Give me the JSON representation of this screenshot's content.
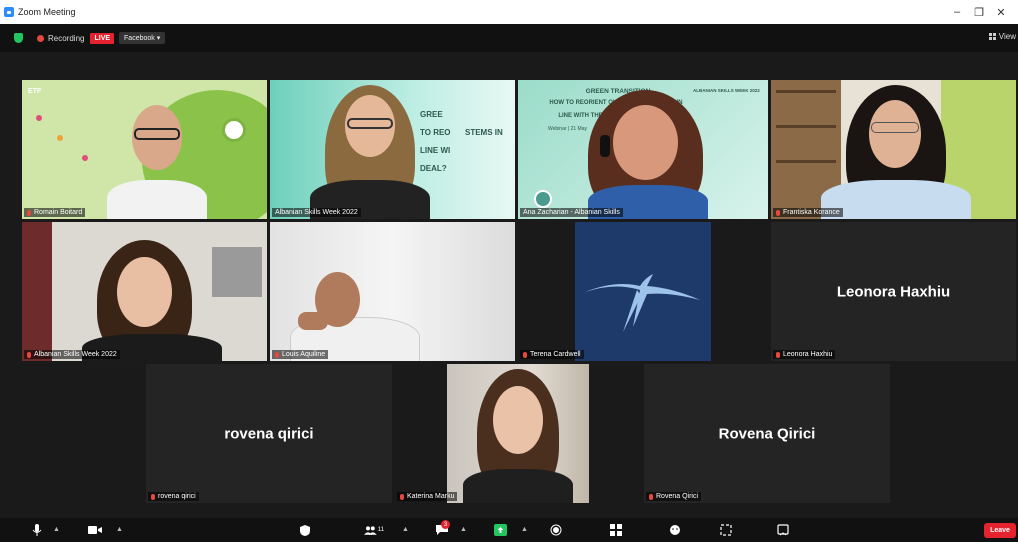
{
  "window": {
    "title": "Zoom Meeting",
    "minimize": "–",
    "restore": "❐",
    "close": "✕"
  },
  "topbar": {
    "recording_label": "Recording",
    "live_label": "LIVE",
    "stream_label": "Facebook ▾",
    "view_label": "View"
  },
  "tiles": [
    {
      "name": "Romain Boitard"
    },
    {
      "name": "Albanian Skills Week 2022"
    },
    {
      "name": "Ana Zacharian - Albanian Skills"
    },
    {
      "name": "Frantiska Korance"
    },
    {
      "name": "Albanian Skills Week 2022"
    },
    {
      "name": "Louis Aquiline"
    },
    {
      "name": "Terena Cardwell"
    },
    {
      "name": "Leonora Haxhiu",
      "display": "Leonora Haxhiu"
    },
    {
      "name": "rovena qirici",
      "display": "rovena qirici"
    },
    {
      "name": "Katerina Marku"
    },
    {
      "name": "Rovena Qirici",
      "display": "Rovena Qirici"
    }
  ],
  "slides": {
    "etf_logo": "ETF",
    "green_title_1": "GREEN TRANSITION",
    "green_title_2": "HOW TO REORIENT OUR SKILLS SYSTEMS IN",
    "green_title_3": "LINE WITH THE GREEN DEAL",
    "webinar": "Webinar | 21 May",
    "skills_week": "ALBANIAN SKILLS WEEK 2022",
    "partial_1": "GREE",
    "partial_2": "TO REO",
    "partial_3": "STEMS IN",
    "partial_4": "LINE WI",
    "partial_5": "DEAL?"
  },
  "toolbar": {
    "participants_count": "11",
    "chat_badge": "3",
    "leave_label": "Leave"
  },
  "colors": {
    "accent_green": "#9be14a",
    "live_red": "#e5232e",
    "zoom_blue": "#2d8cff",
    "terena_bg": "#1e3a6a"
  }
}
